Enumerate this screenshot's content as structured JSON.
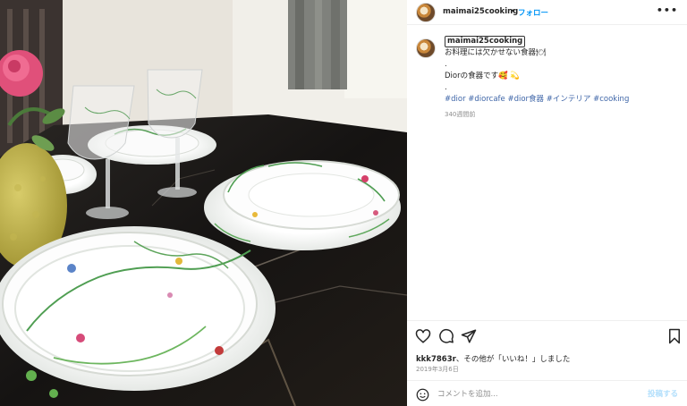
{
  "post": {
    "image_alt": "テーブルに並んだ花柄の食器とワイングラス",
    "username": "maimai25cooking",
    "separator": "•",
    "follow_label": "フォロー",
    "more_icon": "more-horizontal-icon",
    "caption": {
      "username": "maimai25cooking",
      "line1": "お料理には欠かせない食器🍽",
      "line2": ".",
      "line3": "Diorの食器です🥰 💫",
      "line4": ".",
      "hashtags": "#dior #diorcafe #dior食器 #インテリア #cooking",
      "time": "340週間前"
    },
    "actions": {
      "like_icon": "heart-icon",
      "comment_icon": "comment-icon",
      "share_icon": "send-icon",
      "save_icon": "bookmark-icon"
    },
    "likes": {
      "user": "kkk7863r",
      "text": "、その他が「いいね！」しました"
    },
    "date": "2019年3月6日",
    "comment": {
      "emoji_icon": "smiley-icon",
      "placeholder": "コメントを追加...",
      "post_label": "投稿する"
    },
    "colors": {
      "accent": "#0095f6",
      "hashtag": "#3f66a8",
      "muted": "#8e8e8e",
      "post_disabled": "#b2dffc"
    }
  }
}
